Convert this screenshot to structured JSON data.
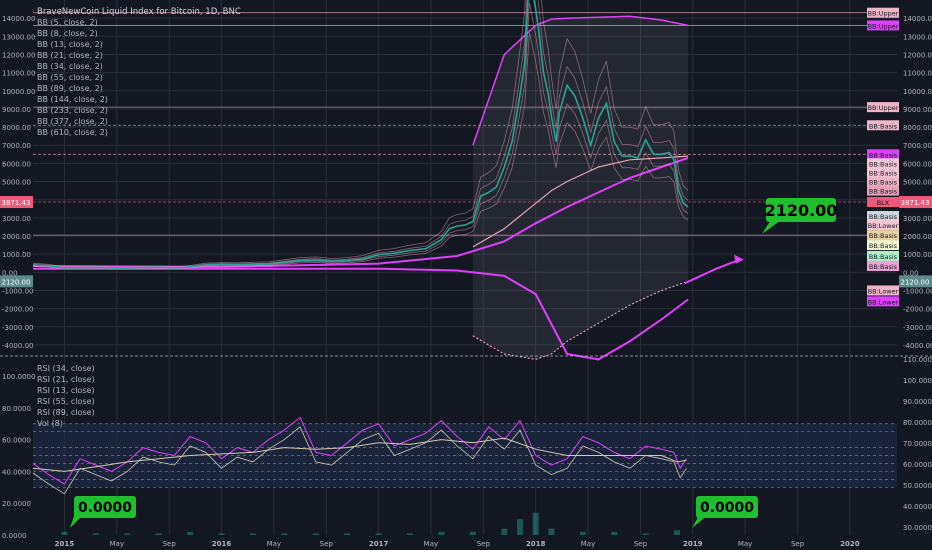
{
  "colors": {
    "background": "#131722",
    "grid": "#2a2e39",
    "text": "#b2b5be",
    "pink_line": "#e8a0b4",
    "magenta": "#e040fb",
    "price": "#f3f3f3",
    "candle_up": "#26a69a",
    "candle_down": "#ef5350",
    "callout_green": "#1fbf2e",
    "rsi_band": "#1c2a44"
  },
  "legend": {
    "title": "BraveNewCoin Liquid Index for Bitcoin, 1D, BNC",
    "items": [
      "BB (5, close, 2)",
      "BB (8, close, 2)",
      "BB (13, close, 2)",
      "BB (21, close, 2)",
      "BB (34, close, 2)",
      "BB (55, close, 2)",
      "BB (89, close, 2)",
      "BB (144, close, 2)",
      "BB (233, close, 2)",
      "BB (377, close, 2)",
      "BB (610, close, 2)"
    ]
  },
  "rsi_legend": {
    "items": [
      "RSI (34, close)",
      "RSI (21, close)",
      "RSI (13, close)",
      "RSI (55, close)",
      "RSI (89, close)",
      "Vol (8)"
    ]
  },
  "callouts": {
    "main_target": "2120.00",
    "rsi_left": "0.0000",
    "rsi_right": "0.0000"
  },
  "chart_data": [
    {
      "type": "line",
      "title": "BraveNewCoin Liquid Index for Bitcoin, 1D, BNC",
      "ylim": [
        -4500,
        15000
      ],
      "y_ticks": [
        -4000,
        -3000,
        -2000,
        -1000,
        0,
        1000,
        2000,
        3000,
        4000,
        5000,
        6000,
        7000,
        8000,
        9000,
        10000,
        11000,
        12000,
        13000,
        14000
      ],
      "y_tick_labels_left": [
        "-4000.00",
        "-3000.00",
        "-2000.00",
        "-1000.00",
        "0.00",
        "1000.00",
        "2000.00",
        "3000.00",
        "4000.00",
        "5000.00",
        "6000.00",
        "7000.00",
        "8000.00",
        "9000.00",
        "10000.00",
        "11000.00",
        "12000.00",
        "13000.00",
        "14000.00"
      ],
      "y_tick_labels_right": [
        "-4000.00",
        "-3000.00",
        "-2000.00",
        "-1000.00",
        "0.00",
        "1000.00",
        "2000.00",
        "3000.00",
        "4000.00",
        "5000.00",
        "6000.00",
        "7000.00",
        "8000.00",
        "9000.00",
        "10000.00",
        "11000.00",
        "12000.00",
        "13000.00",
        "14000.00"
      ],
      "x_ticks": [
        2015,
        2015.333,
        2015.667,
        2016,
        2016.333,
        2016.667,
        2017,
        2017.333,
        2017.667,
        2018,
        2018.333,
        2018.667,
        2019,
        2019.333,
        2019.667,
        2020
      ],
      "x_tick_labels": [
        "2015",
        "May",
        "Sep",
        "2016",
        "May",
        "Sep",
        "2017",
        "May",
        "Sep",
        "2018",
        "May",
        "Sep",
        "2019",
        "May",
        "Sep",
        "2020"
      ],
      "xlim": [
        2014.8,
        2020.3
      ],
      "grid": true,
      "legend_position": "top-left",
      "series": [
        {
          "kind": "price",
          "x": [
            2014.8,
            2014.9,
            2015.0,
            2015.1,
            2015.2,
            2015.3,
            2015.4,
            2015.5,
            2015.6,
            2015.7,
            2015.8,
            2015.9,
            2016.0,
            2016.1,
            2016.2,
            2016.3,
            2016.4,
            2016.5,
            2016.6,
            2016.7,
            2016.8,
            2016.9,
            2017.0,
            2017.1,
            2017.2,
            2017.3,
            2017.4,
            2017.45,
            2017.5,
            2017.55,
            2017.6,
            2017.65,
            2017.7,
            2017.75,
            2017.8,
            2017.85,
            2017.9,
            2017.93,
            2017.96,
            2018.0,
            2018.02,
            2018.05,
            2018.08,
            2018.1,
            2018.13,
            2018.15,
            2018.2,
            2018.25,
            2018.3,
            2018.35,
            2018.4,
            2018.45,
            2018.5,
            2018.55,
            2018.6,
            2018.65,
            2018.7,
            2018.75,
            2018.8,
            2018.85,
            2018.88,
            2018.91,
            2018.94,
            2018.97
          ],
          "y": [
            400,
            350,
            250,
            250,
            270,
            240,
            230,
            260,
            280,
            240,
            300,
            400,
            430,
            420,
            440,
            460,
            550,
            650,
            680,
            610,
            650,
            740,
            970,
            1050,
            1200,
            1300,
            1800,
            2400,
            2550,
            2600,
            2800,
            4200,
            4400,
            4700,
            5800,
            7200,
            9800,
            11500,
            16500,
            14500,
            13300,
            11000,
            9800,
            8600,
            7200,
            8800,
            10300,
            9700,
            8500,
            7000,
            8500,
            9300,
            7200,
            6400,
            6400,
            6300,
            7300,
            6500,
            6500,
            6600,
            6200,
            4500,
            3800,
            3600
          ]
        },
        {
          "kind": "bb_610",
          "x": [
            2014.8,
            2016.0,
            2017.0,
            2017.5,
            2017.8,
            2018.0,
            2018.2,
            2018.4,
            2018.6,
            2018.8,
            2018.97
          ],
          "basis": [
            350,
            300,
            480,
            900,
            1700,
            2700,
            3600,
            4400,
            5200,
            5800,
            6300
          ],
          "upper": null,
          "lower": [
            200,
            200,
            200,
            100,
            -200,
            -1200,
            -4500,
            -4800,
            -3800,
            -2600,
            -1500
          ]
        },
        {
          "kind": "bb_377",
          "x": [
            2017.6,
            2017.8,
            2018.0,
            2018.1,
            2018.2,
            2018.4,
            2018.6,
            2018.8,
            2018.97
          ],
          "upper": [
            7000,
            12000,
            13600,
            13950,
            14000,
            14050,
            14100,
            13900,
            13600
          ],
          "basis": [
            1400,
            2400,
            3800,
            4500,
            5000,
            5800,
            6200,
            6300,
            6400
          ],
          "lower": [
            -3500,
            -4500,
            -4800,
            -4500,
            -3800,
            -2800,
            -1800,
            -1000,
            -500
          ]
        }
      ],
      "horizontal_levels": [
        {
          "value": 14300,
          "style": "solid",
          "label": "BB:Upper"
        },
        {
          "value": 13600,
          "style": "solid",
          "label": "BB:Upper"
        },
        {
          "value": 9100,
          "style": "solid",
          "label": "BB:Upper"
        },
        {
          "value": 8100,
          "style": "dashed",
          "label": "BB:Basis"
        },
        {
          "value": 6500,
          "style": "dashed",
          "label": "BB:Basis"
        },
        {
          "value": 3871.43,
          "style": "dashed",
          "label": "BLX"
        },
        {
          "value": 2050,
          "style": "solid",
          "label": "BB:Lower"
        }
      ],
      "right_badges": [
        {
          "value": 14300,
          "text": "BB:Upper",
          "fill": "#f0b6c8"
        },
        {
          "value": 13600,
          "text": "BB:Upper",
          "fill": "#e040fb"
        },
        {
          "value": 9100,
          "text": "BB:Upper",
          "fill": "#f0b6c8"
        },
        {
          "value": 8100,
          "text": "BB:Basis",
          "fill": "#f0b6c8"
        },
        {
          "value": 6500,
          "text": "BB:Basis",
          "fill": "#e040fb"
        },
        {
          "value": 6000,
          "text": "BB:Basis",
          "fill": "#f4c7d3"
        },
        {
          "value": 5500,
          "text": "BB:Basis",
          "fill": "#f4c7d3"
        },
        {
          "value": 5000,
          "text": "BB:Basis",
          "fill": "#f0b6c8"
        },
        {
          "value": 4500,
          "text": "BB:Basis",
          "fill": "#e8a0b4"
        },
        {
          "value": 3871.43,
          "text": "BLX",
          "fill": "#ef5a7a"
        },
        {
          "value": 3100,
          "text": "BB:Basis",
          "fill": "#cfd8dc"
        },
        {
          "value": 2600,
          "text": "BB:Lower",
          "fill": "#f4c7d3"
        },
        {
          "value": 2050,
          "text": "BB:Basis",
          "fill": "#e8d0a0"
        },
        {
          "value": 1500,
          "text": "BB:Basis",
          "fill": "#f8f8d0"
        },
        {
          "value": 900,
          "text": "BB:Basis",
          "fill": "#b0f0c8"
        },
        {
          "value": 350,
          "text": "BB:Basis",
          "fill": "#f0a0d8"
        },
        {
          "value": -1000,
          "text": "BB:Lower",
          "fill": "#f0b6c8"
        },
        {
          "value": -1600,
          "text": "BB:Lower",
          "fill": "#e040fb"
        }
      ],
      "price_badge": {
        "value": 3871.43,
        "text": "3871.43"
      },
      "level_badge": {
        "value": -500,
        "text": "2120.00"
      },
      "projection": {
        "x": [
          2018.95,
          2019.15,
          2019.3
        ],
        "y": [
          -600,
          200,
          700
        ]
      },
      "target_label": "2120.00"
    },
    {
      "type": "line",
      "title": "",
      "ylim": [
        0,
        112
      ],
      "y_ticks": [
        0,
        20,
        40,
        60,
        80,
        100
      ],
      "y_tick_labels_left": [
        "0.0000",
        "20.0000",
        "40.0000",
        "60.0000",
        "80.0000",
        "100.0000"
      ],
      "y_tick_labels_right": [
        "30.0000",
        "40.0000",
        "50.0000",
        "60.0000",
        "70.0000",
        "80.0000",
        "90.0000",
        "100.0000",
        "110.0000"
      ],
      "band": [
        30,
        70
      ],
      "levels": [
        70,
        65,
        55,
        50,
        45,
        40,
        35,
        30
      ],
      "series": [
        {
          "name": "RSI (13, close)",
          "x": [
            2014.8,
            2014.9,
            2015.0,
            2015.1,
            2015.2,
            2015.3,
            2015.4,
            2015.5,
            2015.6,
            2015.7,
            2015.8,
            2015.9,
            2016.0,
            2016.1,
            2016.2,
            2016.3,
            2016.4,
            2016.5,
            2016.6,
            2016.7,
            2016.8,
            2016.9,
            2017.0,
            2017.1,
            2017.2,
            2017.3,
            2017.4,
            2017.5,
            2017.6,
            2017.7,
            2017.8,
            2017.9,
            2018.0,
            2018.1,
            2018.2,
            2018.3,
            2018.4,
            2018.5,
            2018.6,
            2018.7,
            2018.8,
            2018.88,
            2018.92,
            2018.96
          ],
          "y": [
            45,
            38,
            32,
            48,
            44,
            40,
            46,
            55,
            52,
            50,
            62,
            58,
            48,
            55,
            52,
            60,
            66,
            74,
            52,
            50,
            58,
            66,
            70,
            56,
            60,
            64,
            72,
            62,
            54,
            68,
            60,
            72,
            50,
            44,
            48,
            62,
            58,
            52,
            48,
            56,
            54,
            52,
            42,
            48
          ]
        },
        {
          "name": "RSI (89, close)",
          "x": [
            2014.8,
            2015.0,
            2015.2,
            2015.4,
            2015.6,
            2015.8,
            2016.0,
            2016.2,
            2016.4,
            2016.6,
            2016.8,
            2017.0,
            2017.2,
            2017.4,
            2017.6,
            2017.8,
            2018.0,
            2018.2,
            2018.4,
            2018.6,
            2018.8,
            2018.9,
            2018.96
          ],
          "y": [
            42,
            40,
            43,
            46,
            48,
            50,
            51,
            52,
            55,
            54,
            55,
            58,
            57,
            60,
            58,
            61,
            54,
            50,
            50,
            50,
            50,
            46,
            47
          ]
        },
        {
          "name": "Vol (8)",
          "x": [
            2015.0,
            2015.2,
            2015.4,
            2015.6,
            2015.8,
            2016.0,
            2016.2,
            2016.4,
            2016.6,
            2016.8,
            2017.0,
            2017.2,
            2017.4,
            2017.6,
            2017.8,
            2017.9,
            2018.0,
            2018.1,
            2018.3,
            2018.5,
            2018.7,
            2018.9
          ],
          "y": [
            2,
            1,
            1,
            1,
            2,
            1,
            1,
            1,
            1,
            1,
            1,
            1,
            2,
            2,
            4,
            10,
            14,
            4,
            2,
            2,
            1,
            3
          ]
        }
      ],
      "rsi_left_label": "0.0000",
      "rsi_right_label": "0.0000"
    }
  ]
}
